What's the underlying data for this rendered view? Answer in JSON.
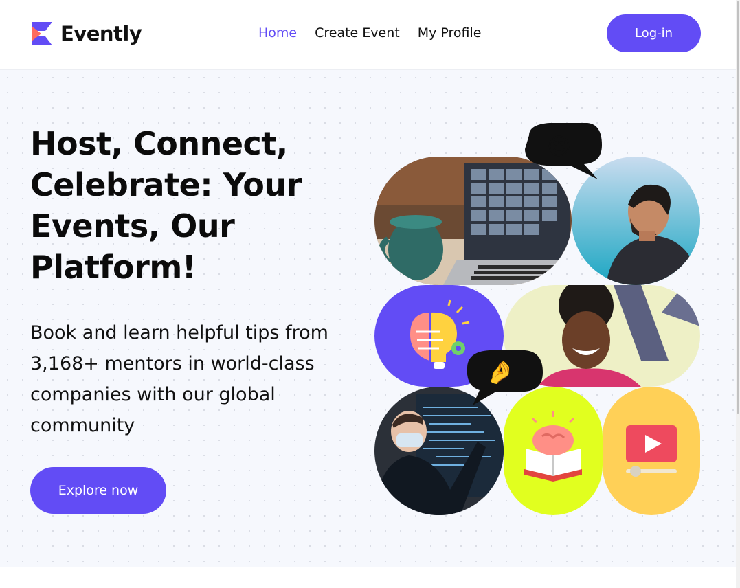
{
  "brand": {
    "name": "Evently",
    "logo_icon": "evently-logo-icon",
    "accent": "#624cf5"
  },
  "nav": {
    "items": [
      {
        "label": "Home",
        "active": true
      },
      {
        "label": "Create Event",
        "active": false
      },
      {
        "label": "My Profile",
        "active": false
      }
    ]
  },
  "header": {
    "login_label": "Log-in"
  },
  "hero": {
    "headline": "Host, Connect, Celebrate: Your Events, Our Platform!",
    "subheadline": "Book and learn helpful tips from 3,168+ mentors in world-class companies with our global community",
    "cta_label": "Explore now"
  },
  "collage": {
    "emoji_top": "😍",
    "emoji_middle": "🤌",
    "tiles": [
      "laptop-video-call-photo",
      "smiling-man-photo",
      "brain-lightbulb-icon",
      "laughing-woman-photo",
      "presenter-masked-man-photo",
      "brain-book-icon",
      "video-play-icon"
    ]
  }
}
